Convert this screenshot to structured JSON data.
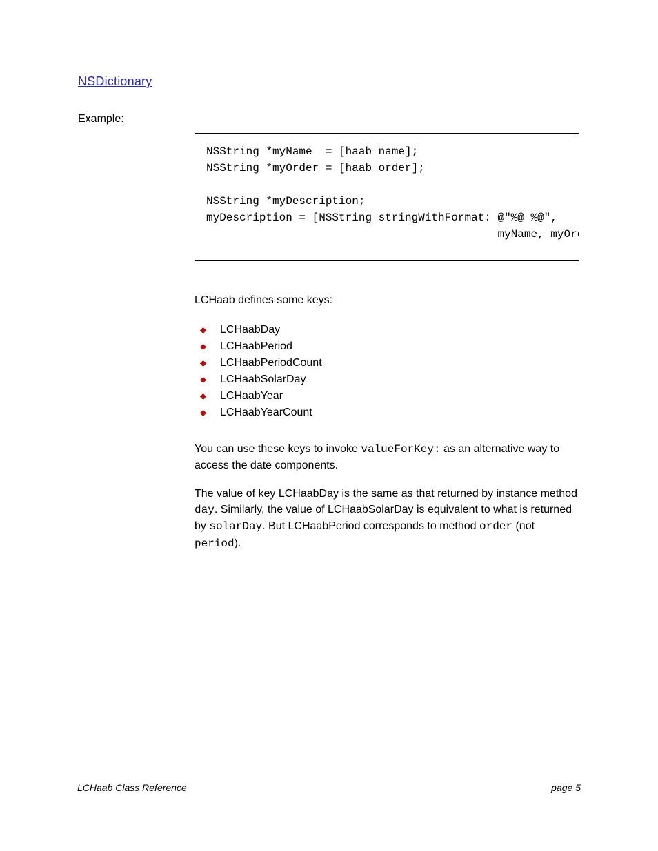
{
  "colors": {
    "link": "#2d2db3",
    "bullet": "#b30f0f"
  },
  "link": {
    "text": "NSDictionary"
  },
  "example": {
    "label": "Example:",
    "code": "NSString *myName  = [haab name];\nNSString *myOrder = [haab order];\n\nNSString *myDescription;\nmyDescription = [NSString stringWithFormat: @\"%@ %@\",\n                                            myName, myOrder];"
  },
  "intro": "LCHaab defines some keys:",
  "keys": [
    "LCHaabDay",
    "LCHaabPeriod",
    "LCHaabPeriodCount",
    "LCHaabSolarDay",
    "LCHaabYear",
    "LCHaabYearCount"
  ],
  "para2": {
    "prefix": "You can use these keys to invoke ",
    "midlink": "valueForKey:",
    "suffix": " as an alternative way to access the date components."
  },
  "para3": {
    "prefix": "The value of key LCHaabDay is the same as that returned by instance method ",
    "method1": "day",
    "mid1": ". Similarly, the value of LCHaabSolarDay is equivalent to what is returned by ",
    "method2": "solarDay",
    "mid2": ". But LCHaabPeriod corresponds to method ",
    "method3": "order",
    "mid3": " (not ",
    "method4": "period",
    "tail": ")."
  },
  "footer": {
    "left": "LCHaab Class Reference",
    "right_label": "page ",
    "right_page": "5"
  }
}
